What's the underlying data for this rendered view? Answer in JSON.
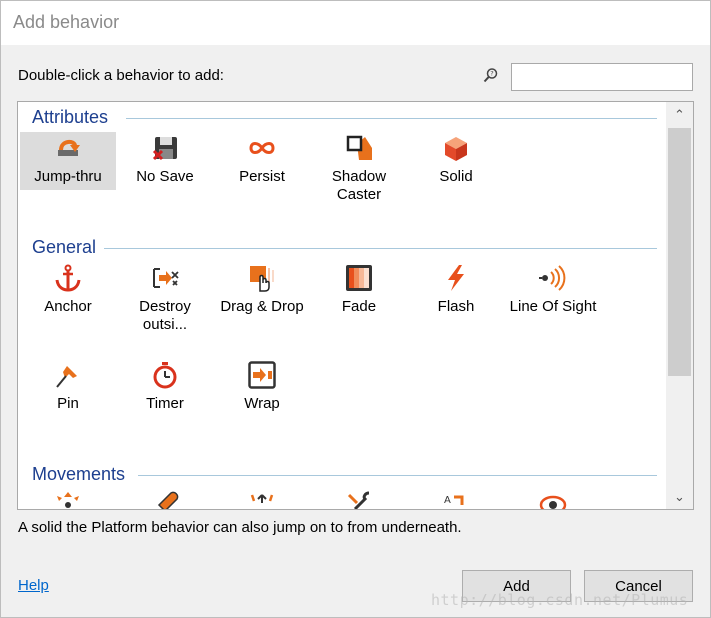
{
  "window": {
    "title": "Add behavior"
  },
  "instruction": "Double-click a behavior to add:",
  "search": {
    "value": "",
    "placeholder": ""
  },
  "groups": [
    {
      "name": "Attributes",
      "items": [
        {
          "label": "Jump-thru",
          "icon": "jump-thru-icon",
          "selected": true
        },
        {
          "label": "No Save",
          "icon": "no-save-icon"
        },
        {
          "label": "Persist",
          "icon": "persist-icon"
        },
        {
          "label": "Shadow\nCaster",
          "icon": "shadow-caster-icon"
        },
        {
          "label": "Solid",
          "icon": "solid-icon"
        }
      ]
    },
    {
      "name": "General",
      "items": [
        {
          "label": "Anchor",
          "icon": "anchor-icon"
        },
        {
          "label": "Destroy\noutsi...",
          "icon": "destroy-outside-icon"
        },
        {
          "label": "Drag & Drop",
          "icon": "drag-drop-icon"
        },
        {
          "label": "Fade",
          "icon": "fade-icon"
        },
        {
          "label": "Flash",
          "icon": "flash-icon"
        },
        {
          "label": "Line Of Sight",
          "icon": "line-of-sight-icon"
        },
        {
          "label": "Pin",
          "icon": "pin-icon"
        },
        {
          "label": "Timer",
          "icon": "timer-icon"
        },
        {
          "label": "Wrap",
          "icon": "wrap-icon"
        }
      ]
    },
    {
      "name": "Movements",
      "items": [
        {
          "label": "",
          "icon": "8-direction-icon"
        },
        {
          "label": "",
          "icon": "bullet-icon"
        },
        {
          "label": "",
          "icon": "car-icon"
        },
        {
          "label": "",
          "icon": "custom-movement-icon"
        },
        {
          "label": "",
          "icon": "pathfinding-icon"
        },
        {
          "label": "",
          "icon": "orbit-icon"
        }
      ]
    }
  ],
  "description": "A solid the Platform behavior can also jump on to from underneath.",
  "buttons": {
    "help": "Help",
    "add": "Add",
    "cancel": "Cancel"
  },
  "watermark": "http://blog.csdn.net/Plumus",
  "colors": {
    "accent": "#e8711c",
    "header": "#1d3f8f",
    "link": "#0066cc"
  }
}
